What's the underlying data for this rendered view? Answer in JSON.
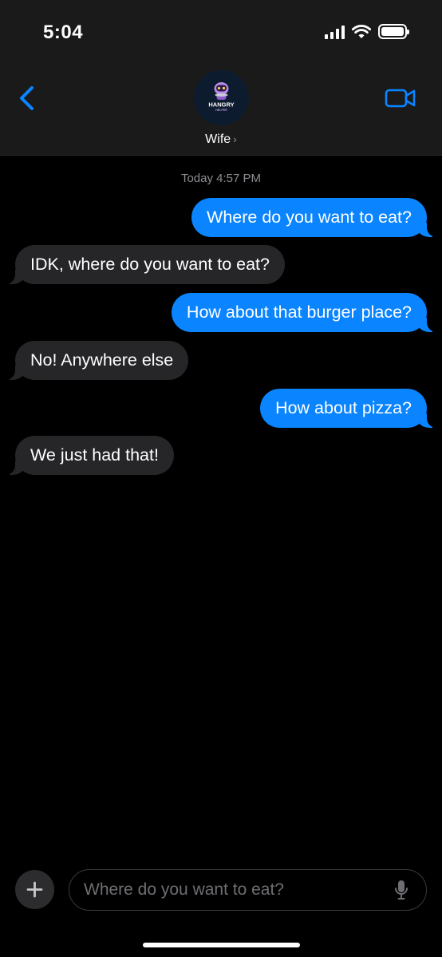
{
  "status_bar": {
    "time": "5:04"
  },
  "header": {
    "contact_name": "Wife",
    "contact_chevron": "›",
    "avatar_logo_text": "HANGRY HELPER",
    "back_icon": "chevron-left",
    "video_icon": "video-camera"
  },
  "conversation": {
    "timestamp": "Today 4:57 PM",
    "messages": [
      {
        "direction": "sent",
        "text": "Where do you want to eat?"
      },
      {
        "direction": "received",
        "text": "IDK, where do you want to eat?"
      },
      {
        "direction": "sent",
        "text": "How about that burger place?"
      },
      {
        "direction": "received",
        "text": "No! Anywhere else"
      },
      {
        "direction": "sent",
        "text": "How about pizza?"
      },
      {
        "direction": "received",
        "text": "We just had that!"
      }
    ]
  },
  "composer": {
    "placeholder": "Where do you want to eat?",
    "plus_icon": "plus",
    "mic_icon": "microphone"
  },
  "colors": {
    "sent_bubble": "#0a84ff",
    "received_bubble": "#262628",
    "accent": "#0a84ff",
    "header_bg": "#1a1a1a"
  }
}
